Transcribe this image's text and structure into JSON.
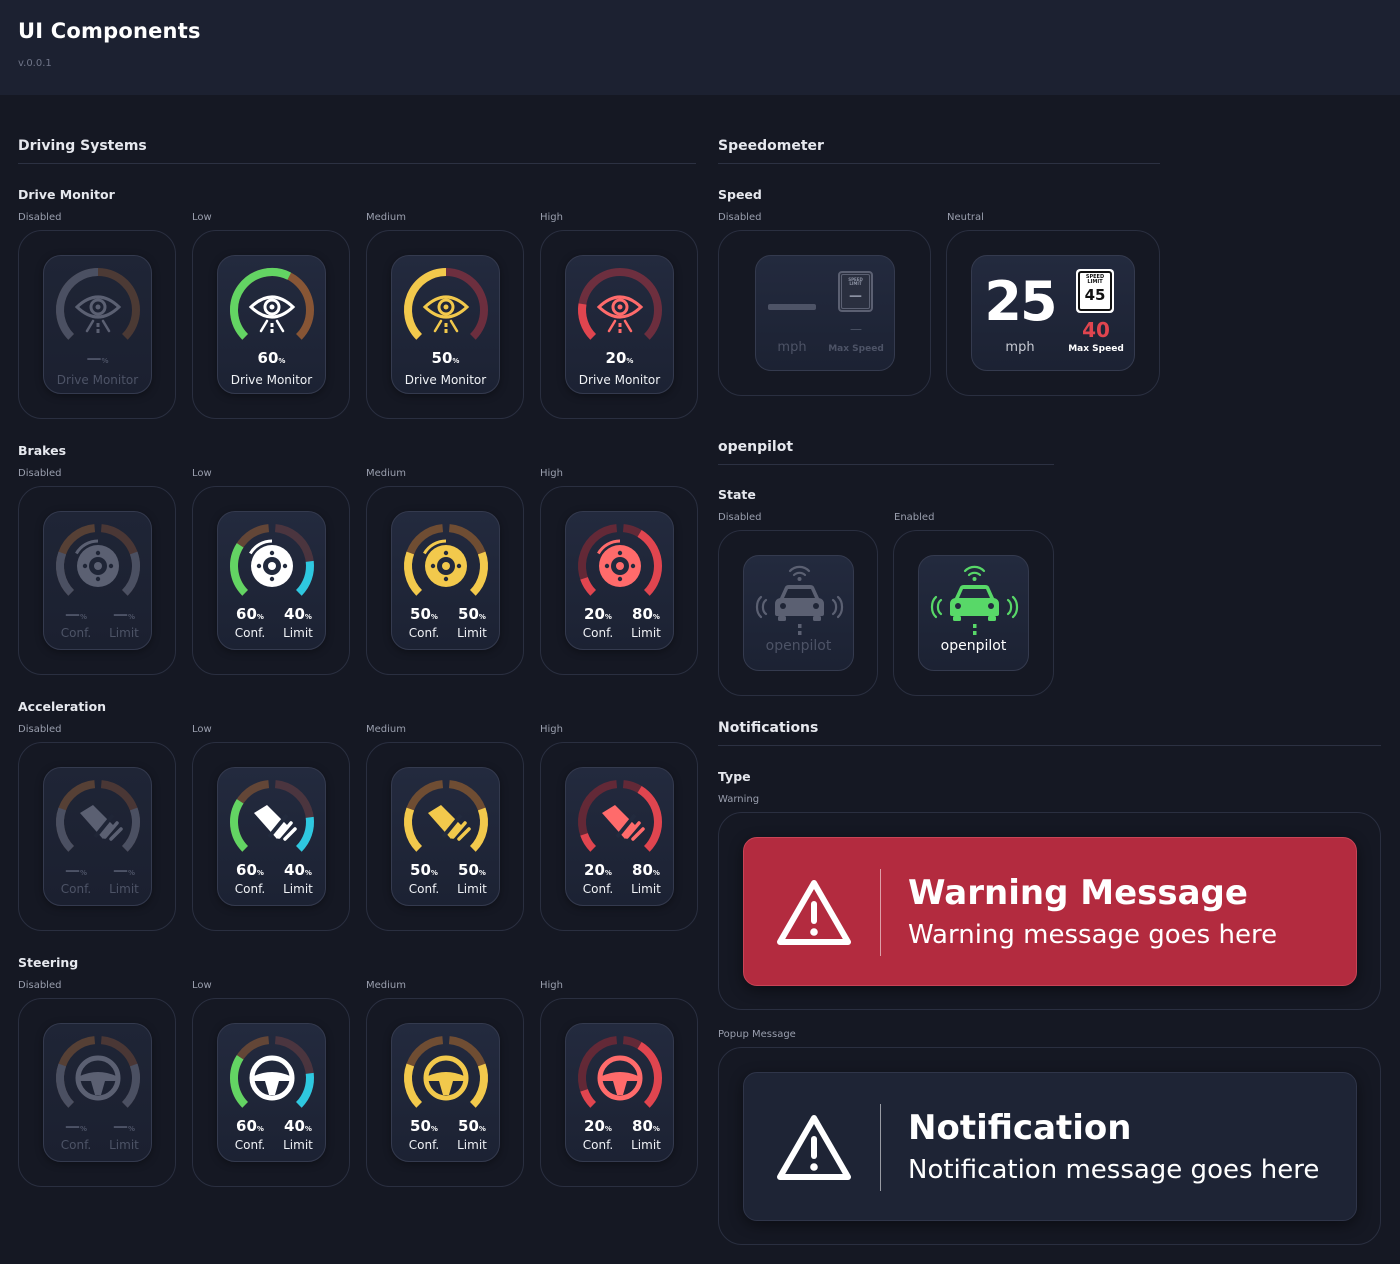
{
  "header": {
    "title": "UI Components",
    "version": "v.0.0.1"
  },
  "driving_systems": {
    "title": "Driving Systems",
    "states": [
      "Disabled",
      "Low",
      "Medium",
      "High"
    ],
    "drive_monitor": {
      "title": "Drive Monitor",
      "tiles": [
        {
          "state": "Disabled",
          "value": "—",
          "unit": "%",
          "label": "Drive Monitor"
        },
        {
          "state": "Low",
          "value": "60",
          "unit": "%",
          "label": "Drive Monitor"
        },
        {
          "state": "Medium",
          "value": "50",
          "unit": "%",
          "label": "Drive Monitor"
        },
        {
          "state": "High",
          "value": "20",
          "unit": "%",
          "label": "Drive Monitor"
        }
      ]
    },
    "brakes": {
      "title": "Brakes",
      "tiles": [
        {
          "state": "Disabled",
          "conf": "—",
          "limit": "—",
          "unit": "%",
          "conf_label": "Conf.",
          "limit_label": "Limit"
        },
        {
          "state": "Low",
          "conf": "60",
          "limit": "40",
          "unit": "%",
          "conf_label": "Conf.",
          "limit_label": "Limit"
        },
        {
          "state": "Medium",
          "conf": "50",
          "limit": "50",
          "unit": "%",
          "conf_label": "Conf.",
          "limit_label": "Limit"
        },
        {
          "state": "High",
          "conf": "20",
          "limit": "80",
          "unit": "%",
          "conf_label": "Conf.",
          "limit_label": "Limit"
        }
      ]
    },
    "acceleration": {
      "title": "Acceleration",
      "tiles": [
        {
          "state": "Disabled",
          "conf": "—",
          "limit": "—",
          "unit": "%",
          "conf_label": "Conf.",
          "limit_label": "Limit"
        },
        {
          "state": "Low",
          "conf": "60",
          "limit": "40",
          "unit": "%",
          "conf_label": "Conf.",
          "limit_label": "Limit"
        },
        {
          "state": "Medium",
          "conf": "50",
          "limit": "50",
          "unit": "%",
          "conf_label": "Conf.",
          "limit_label": "Limit"
        },
        {
          "state": "High",
          "conf": "20",
          "limit": "80",
          "unit": "%",
          "conf_label": "Conf.",
          "limit_label": "Limit"
        }
      ]
    },
    "steering": {
      "title": "Steering",
      "tiles": [
        {
          "state": "Disabled",
          "conf": "—",
          "limit": "—",
          "unit": "%",
          "conf_label": "Conf.",
          "limit_label": "Limit"
        },
        {
          "state": "Low",
          "conf": "60",
          "limit": "40",
          "unit": "%",
          "conf_label": "Conf.",
          "limit_label": "Limit"
        },
        {
          "state": "Medium",
          "conf": "50",
          "limit": "50",
          "unit": "%",
          "conf_label": "Conf.",
          "limit_label": "Limit"
        },
        {
          "state": "High",
          "conf": "20",
          "limit": "80",
          "unit": "%",
          "conf_label": "Conf.",
          "limit_label": "Limit"
        }
      ]
    }
  },
  "speedometer": {
    "title": "Speedometer",
    "group": "Speed",
    "disabled": {
      "state": "Disabled",
      "speed": "",
      "unit": "mph",
      "limit_sign_top": "SPEED",
      "limit_sign_bottom": "LIMIT",
      "limit_value": "—",
      "max_speed": "—",
      "max_label": "Max Speed"
    },
    "neutral": {
      "state": "Neutral",
      "speed": "25",
      "unit": "mph",
      "limit_sign_top": "SPEED",
      "limit_sign_bottom": "LIMIT",
      "limit_value": "45",
      "max_speed": "40",
      "max_label": "Max Speed"
    }
  },
  "openpilot": {
    "title": "openpilot",
    "group": "State",
    "disabled": {
      "state": "Disabled",
      "label": "openpilot"
    },
    "enabled": {
      "state": "Enabled",
      "label": "openpilot"
    }
  },
  "notifications": {
    "title": "Notifications",
    "group": "Type",
    "warning": {
      "state": "Warning",
      "title": "Warning Message",
      "message": "Warning message goes here"
    },
    "popup": {
      "state": "Popup Message",
      "title": "Notification",
      "message": "Notification message goes here"
    }
  },
  "colors": {
    "low": "#63d463",
    "low_limit": "#2ec8e0",
    "medium": "#f2c94c",
    "high": "#e0454f",
    "disabled": "#5b6072",
    "ring_track_brown": "#7a5035",
    "enabled_green": "#58d868",
    "warning_bg": "#b32b3f",
    "notification_bg": "#1e2435"
  },
  "icons": [
    "eye-icon",
    "brake-disc-icon",
    "acceleration-icon",
    "steering-wheel-icon",
    "car-wifi-icon",
    "warning-triangle-icon",
    "speed-limit-sign-icon"
  ]
}
